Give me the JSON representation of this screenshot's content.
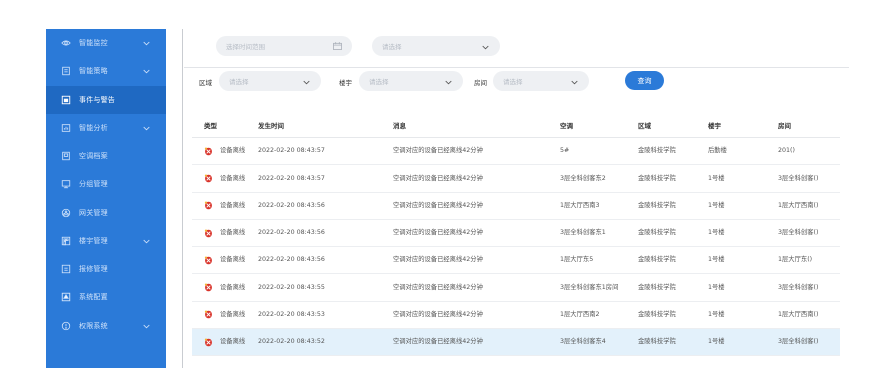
{
  "colors": {
    "accent": "#2b7ad8",
    "active": "#1f69c2",
    "highlight_row": "#e3f1fb",
    "alarm_icon": "#d9342b"
  },
  "sidebar": {
    "items": [
      {
        "label": "智能监控",
        "icon": "eye-icon",
        "has_arrow": true
      },
      {
        "label": "智能策略",
        "icon": "doc-icon",
        "has_arrow": true
      },
      {
        "label": "事件与警告",
        "icon": "alert-box-icon",
        "has_arrow": false,
        "active": true
      },
      {
        "label": "智能分析",
        "icon": "chart-icon",
        "has_arrow": true
      },
      {
        "label": "空调档案",
        "icon": "file-icon",
        "has_arrow": false
      },
      {
        "label": "分组管理",
        "icon": "monitor-icon",
        "has_arrow": false
      },
      {
        "label": "网关管理",
        "icon": "network-icon",
        "has_arrow": false
      },
      {
        "label": "楼宇管理",
        "icon": "building-icon",
        "has_arrow": true
      },
      {
        "label": "报修管理",
        "icon": "repair-icon",
        "has_arrow": false
      },
      {
        "label": "系统配置",
        "icon": "settings-box-icon",
        "has_arrow": false
      },
      {
        "label": "权限系统",
        "icon": "shield-icon",
        "has_arrow": true
      }
    ]
  },
  "filters": {
    "date_placeholder": "选择时间范围",
    "select_placeholder": "请选择",
    "area_label": "区域",
    "area_placeholder": "请选择",
    "building_label": "楼宇",
    "building_placeholder": "请选择",
    "room_label": "房间",
    "room_placeholder": "请选择",
    "query_label": "查询"
  },
  "table": {
    "headers": {
      "type": "类型",
      "time": "发生时间",
      "message": "消息",
      "ac": "空调",
      "area": "区域",
      "building": "楼宇",
      "room": "房间"
    },
    "rows": [
      {
        "type": "设备离线",
        "time": "2022-02-20 08:43:57",
        "message": "空调对应的设备已经离线42分钟",
        "ac": "5#",
        "area": "金陵科技学院",
        "building": "后勤楼",
        "room": "201()"
      },
      {
        "type": "设备离线",
        "time": "2022-02-20 08:43:57",
        "message": "空调对应的设备已经离线42分钟",
        "ac": "3层全科创客东2",
        "area": "金陵科技学院",
        "building": "1号楼",
        "room": "3层全科创客()"
      },
      {
        "type": "设备离线",
        "time": "2022-02-20 08:43:56",
        "message": "空调对应的设备已经离线42分钟",
        "ac": "1层大厅西南3",
        "area": "金陵科技学院",
        "building": "1号楼",
        "room": "1层大厅西南()"
      },
      {
        "type": "设备离线",
        "time": "2022-02-20 08:43:56",
        "message": "空调对应的设备已经离线42分钟",
        "ac": "3层全科创客东1",
        "area": "金陵科技学院",
        "building": "1号楼",
        "room": "3层全科创客()"
      },
      {
        "type": "设备离线",
        "time": "2022-02-20 08:43:56",
        "message": "空调对应的设备已经离线42分钟",
        "ac": "1层大厅东5",
        "area": "金陵科技学院",
        "building": "1号楼",
        "room": "1层大厅东()"
      },
      {
        "type": "设备离线",
        "time": "2022-02-20 08:43:55",
        "message": "空调对应的设备已经离线42分钟",
        "ac": "3层全科创客东1房间",
        "area": "金陵科技学院",
        "building": "1号楼",
        "room": "3层全科创客()"
      },
      {
        "type": "设备离线",
        "time": "2022-02-20 08:43:53",
        "message": "空调对应的设备已经离线42分钟",
        "ac": "1层大厅西南2",
        "area": "金陵科技学院",
        "building": "1号楼",
        "room": "1层大厅西南()"
      },
      {
        "type": "设备离线",
        "time": "2022-02-20 08:43:52",
        "message": "空调对应的设备已经离线42分钟",
        "ac": "3层全科创客东4",
        "area": "金陵科技学院",
        "building": "1号楼",
        "room": "3层全科创客()",
        "highlighted": true
      }
    ]
  }
}
